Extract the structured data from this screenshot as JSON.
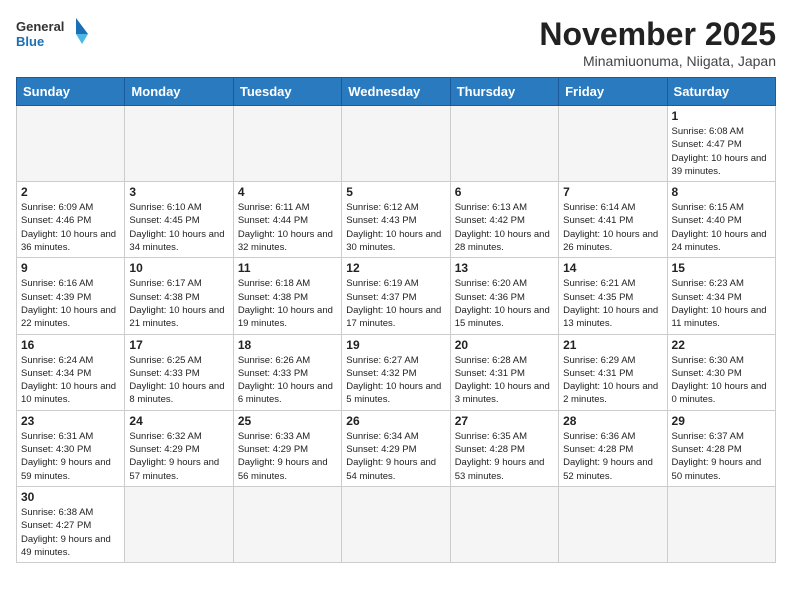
{
  "logo": {
    "general": "General",
    "blue": "Blue"
  },
  "header": {
    "title": "November 2025",
    "subtitle": "Minamiuonuma, Niigata, Japan"
  },
  "weekdays": [
    "Sunday",
    "Monday",
    "Tuesday",
    "Wednesday",
    "Thursday",
    "Friday",
    "Saturday"
  ],
  "weeks": [
    [
      {
        "day": "",
        "info": ""
      },
      {
        "day": "",
        "info": ""
      },
      {
        "day": "",
        "info": ""
      },
      {
        "day": "",
        "info": ""
      },
      {
        "day": "",
        "info": ""
      },
      {
        "day": "",
        "info": ""
      },
      {
        "day": "1",
        "info": "Sunrise: 6:08 AM\nSunset: 4:47 PM\nDaylight: 10 hours and 39 minutes."
      }
    ],
    [
      {
        "day": "2",
        "info": "Sunrise: 6:09 AM\nSunset: 4:46 PM\nDaylight: 10 hours and 36 minutes."
      },
      {
        "day": "3",
        "info": "Sunrise: 6:10 AM\nSunset: 4:45 PM\nDaylight: 10 hours and 34 minutes."
      },
      {
        "day": "4",
        "info": "Sunrise: 6:11 AM\nSunset: 4:44 PM\nDaylight: 10 hours and 32 minutes."
      },
      {
        "day": "5",
        "info": "Sunrise: 6:12 AM\nSunset: 4:43 PM\nDaylight: 10 hours and 30 minutes."
      },
      {
        "day": "6",
        "info": "Sunrise: 6:13 AM\nSunset: 4:42 PM\nDaylight: 10 hours and 28 minutes."
      },
      {
        "day": "7",
        "info": "Sunrise: 6:14 AM\nSunset: 4:41 PM\nDaylight: 10 hours and 26 minutes."
      },
      {
        "day": "8",
        "info": "Sunrise: 6:15 AM\nSunset: 4:40 PM\nDaylight: 10 hours and 24 minutes."
      }
    ],
    [
      {
        "day": "9",
        "info": "Sunrise: 6:16 AM\nSunset: 4:39 PM\nDaylight: 10 hours and 22 minutes."
      },
      {
        "day": "10",
        "info": "Sunrise: 6:17 AM\nSunset: 4:38 PM\nDaylight: 10 hours and 21 minutes."
      },
      {
        "day": "11",
        "info": "Sunrise: 6:18 AM\nSunset: 4:38 PM\nDaylight: 10 hours and 19 minutes."
      },
      {
        "day": "12",
        "info": "Sunrise: 6:19 AM\nSunset: 4:37 PM\nDaylight: 10 hours and 17 minutes."
      },
      {
        "day": "13",
        "info": "Sunrise: 6:20 AM\nSunset: 4:36 PM\nDaylight: 10 hours and 15 minutes."
      },
      {
        "day": "14",
        "info": "Sunrise: 6:21 AM\nSunset: 4:35 PM\nDaylight: 10 hours and 13 minutes."
      },
      {
        "day": "15",
        "info": "Sunrise: 6:23 AM\nSunset: 4:34 PM\nDaylight: 10 hours and 11 minutes."
      }
    ],
    [
      {
        "day": "16",
        "info": "Sunrise: 6:24 AM\nSunset: 4:34 PM\nDaylight: 10 hours and 10 minutes."
      },
      {
        "day": "17",
        "info": "Sunrise: 6:25 AM\nSunset: 4:33 PM\nDaylight: 10 hours and 8 minutes."
      },
      {
        "day": "18",
        "info": "Sunrise: 6:26 AM\nSunset: 4:33 PM\nDaylight: 10 hours and 6 minutes."
      },
      {
        "day": "19",
        "info": "Sunrise: 6:27 AM\nSunset: 4:32 PM\nDaylight: 10 hours and 5 minutes."
      },
      {
        "day": "20",
        "info": "Sunrise: 6:28 AM\nSunset: 4:31 PM\nDaylight: 10 hours and 3 minutes."
      },
      {
        "day": "21",
        "info": "Sunrise: 6:29 AM\nSunset: 4:31 PM\nDaylight: 10 hours and 2 minutes."
      },
      {
        "day": "22",
        "info": "Sunrise: 6:30 AM\nSunset: 4:30 PM\nDaylight: 10 hours and 0 minutes."
      }
    ],
    [
      {
        "day": "23",
        "info": "Sunrise: 6:31 AM\nSunset: 4:30 PM\nDaylight: 9 hours and 59 minutes."
      },
      {
        "day": "24",
        "info": "Sunrise: 6:32 AM\nSunset: 4:29 PM\nDaylight: 9 hours and 57 minutes."
      },
      {
        "day": "25",
        "info": "Sunrise: 6:33 AM\nSunset: 4:29 PM\nDaylight: 9 hours and 56 minutes."
      },
      {
        "day": "26",
        "info": "Sunrise: 6:34 AM\nSunset: 4:29 PM\nDaylight: 9 hours and 54 minutes."
      },
      {
        "day": "27",
        "info": "Sunrise: 6:35 AM\nSunset: 4:28 PM\nDaylight: 9 hours and 53 minutes."
      },
      {
        "day": "28",
        "info": "Sunrise: 6:36 AM\nSunset: 4:28 PM\nDaylight: 9 hours and 52 minutes."
      },
      {
        "day": "29",
        "info": "Sunrise: 6:37 AM\nSunset: 4:28 PM\nDaylight: 9 hours and 50 minutes."
      }
    ],
    [
      {
        "day": "30",
        "info": "Sunrise: 6:38 AM\nSunset: 4:27 PM\nDaylight: 9 hours and 49 minutes."
      },
      {
        "day": "",
        "info": ""
      },
      {
        "day": "",
        "info": ""
      },
      {
        "day": "",
        "info": ""
      },
      {
        "day": "",
        "info": ""
      },
      {
        "day": "",
        "info": ""
      },
      {
        "day": "",
        "info": ""
      }
    ]
  ]
}
